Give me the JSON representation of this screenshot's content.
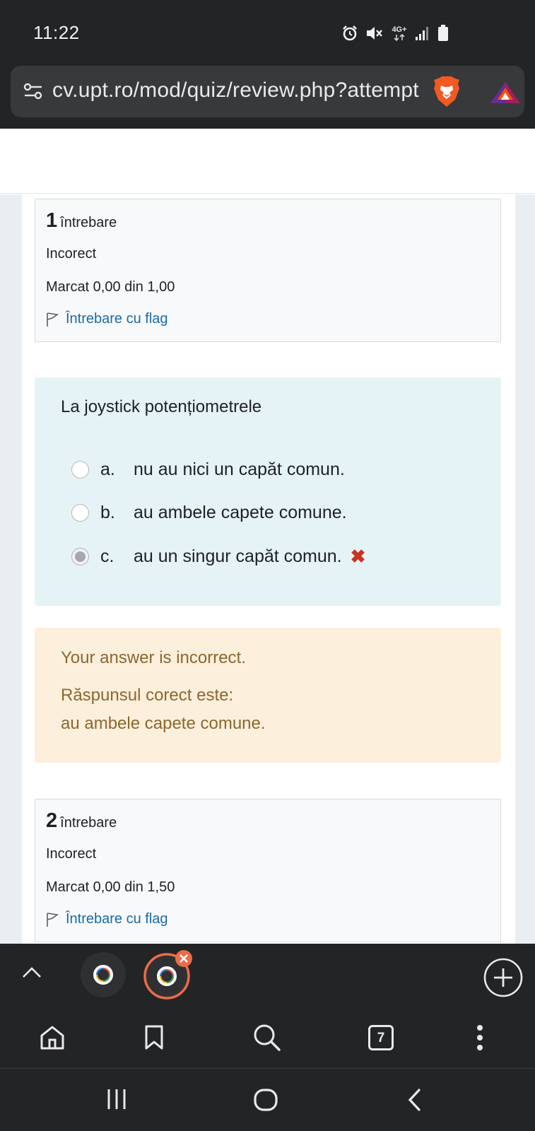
{
  "status_bar": {
    "time": "11:22",
    "network": "4G+",
    "icons": [
      "alarm-icon",
      "mute-icon",
      "signal-icon",
      "battery-icon"
    ]
  },
  "browser": {
    "url": "cv.upt.ro/mod/quiz/review.php?attempt",
    "tab_count": "7",
    "icons": [
      "site-settings-icon",
      "brave-shield-icon",
      "bat-rewards-icon"
    ]
  },
  "questions": [
    {
      "number": "1",
      "label": "întrebare",
      "state": "Incorect",
      "grade": "Marcat 0,00 din 1,00",
      "flag_label": "Întrebare cu flag"
    },
    {
      "number": "2",
      "label": "întrebare",
      "state": "Incorect",
      "grade": "Marcat 0,00 din 1,50",
      "flag_label": "Întrebare cu flag"
    }
  ],
  "question_body": {
    "text": "La joystick potențiometrele",
    "answers": [
      {
        "letter": "a.",
        "text": "nu au nici un capăt comun.",
        "selected": false
      },
      {
        "letter": "b.",
        "text": "au ambele capete comune.",
        "selected": false
      },
      {
        "letter": "c.",
        "text": "au un singur capăt comun.",
        "selected": true,
        "mark": "✖"
      }
    ]
  },
  "feedback": {
    "result": "Your answer is incorrect.",
    "correct_label": "Răspunsul corect este:",
    "correct_answer": "au ambele capete comune."
  },
  "colors": {
    "wrong": "#ca3120",
    "link": "#1a6aa8",
    "feedback_text": "#8e662e",
    "question_bg": "#e6f3f6",
    "feedback_bg": "#fcefdc",
    "chrome_dark": "#232426",
    "active_tab": "#ec6b4a"
  }
}
